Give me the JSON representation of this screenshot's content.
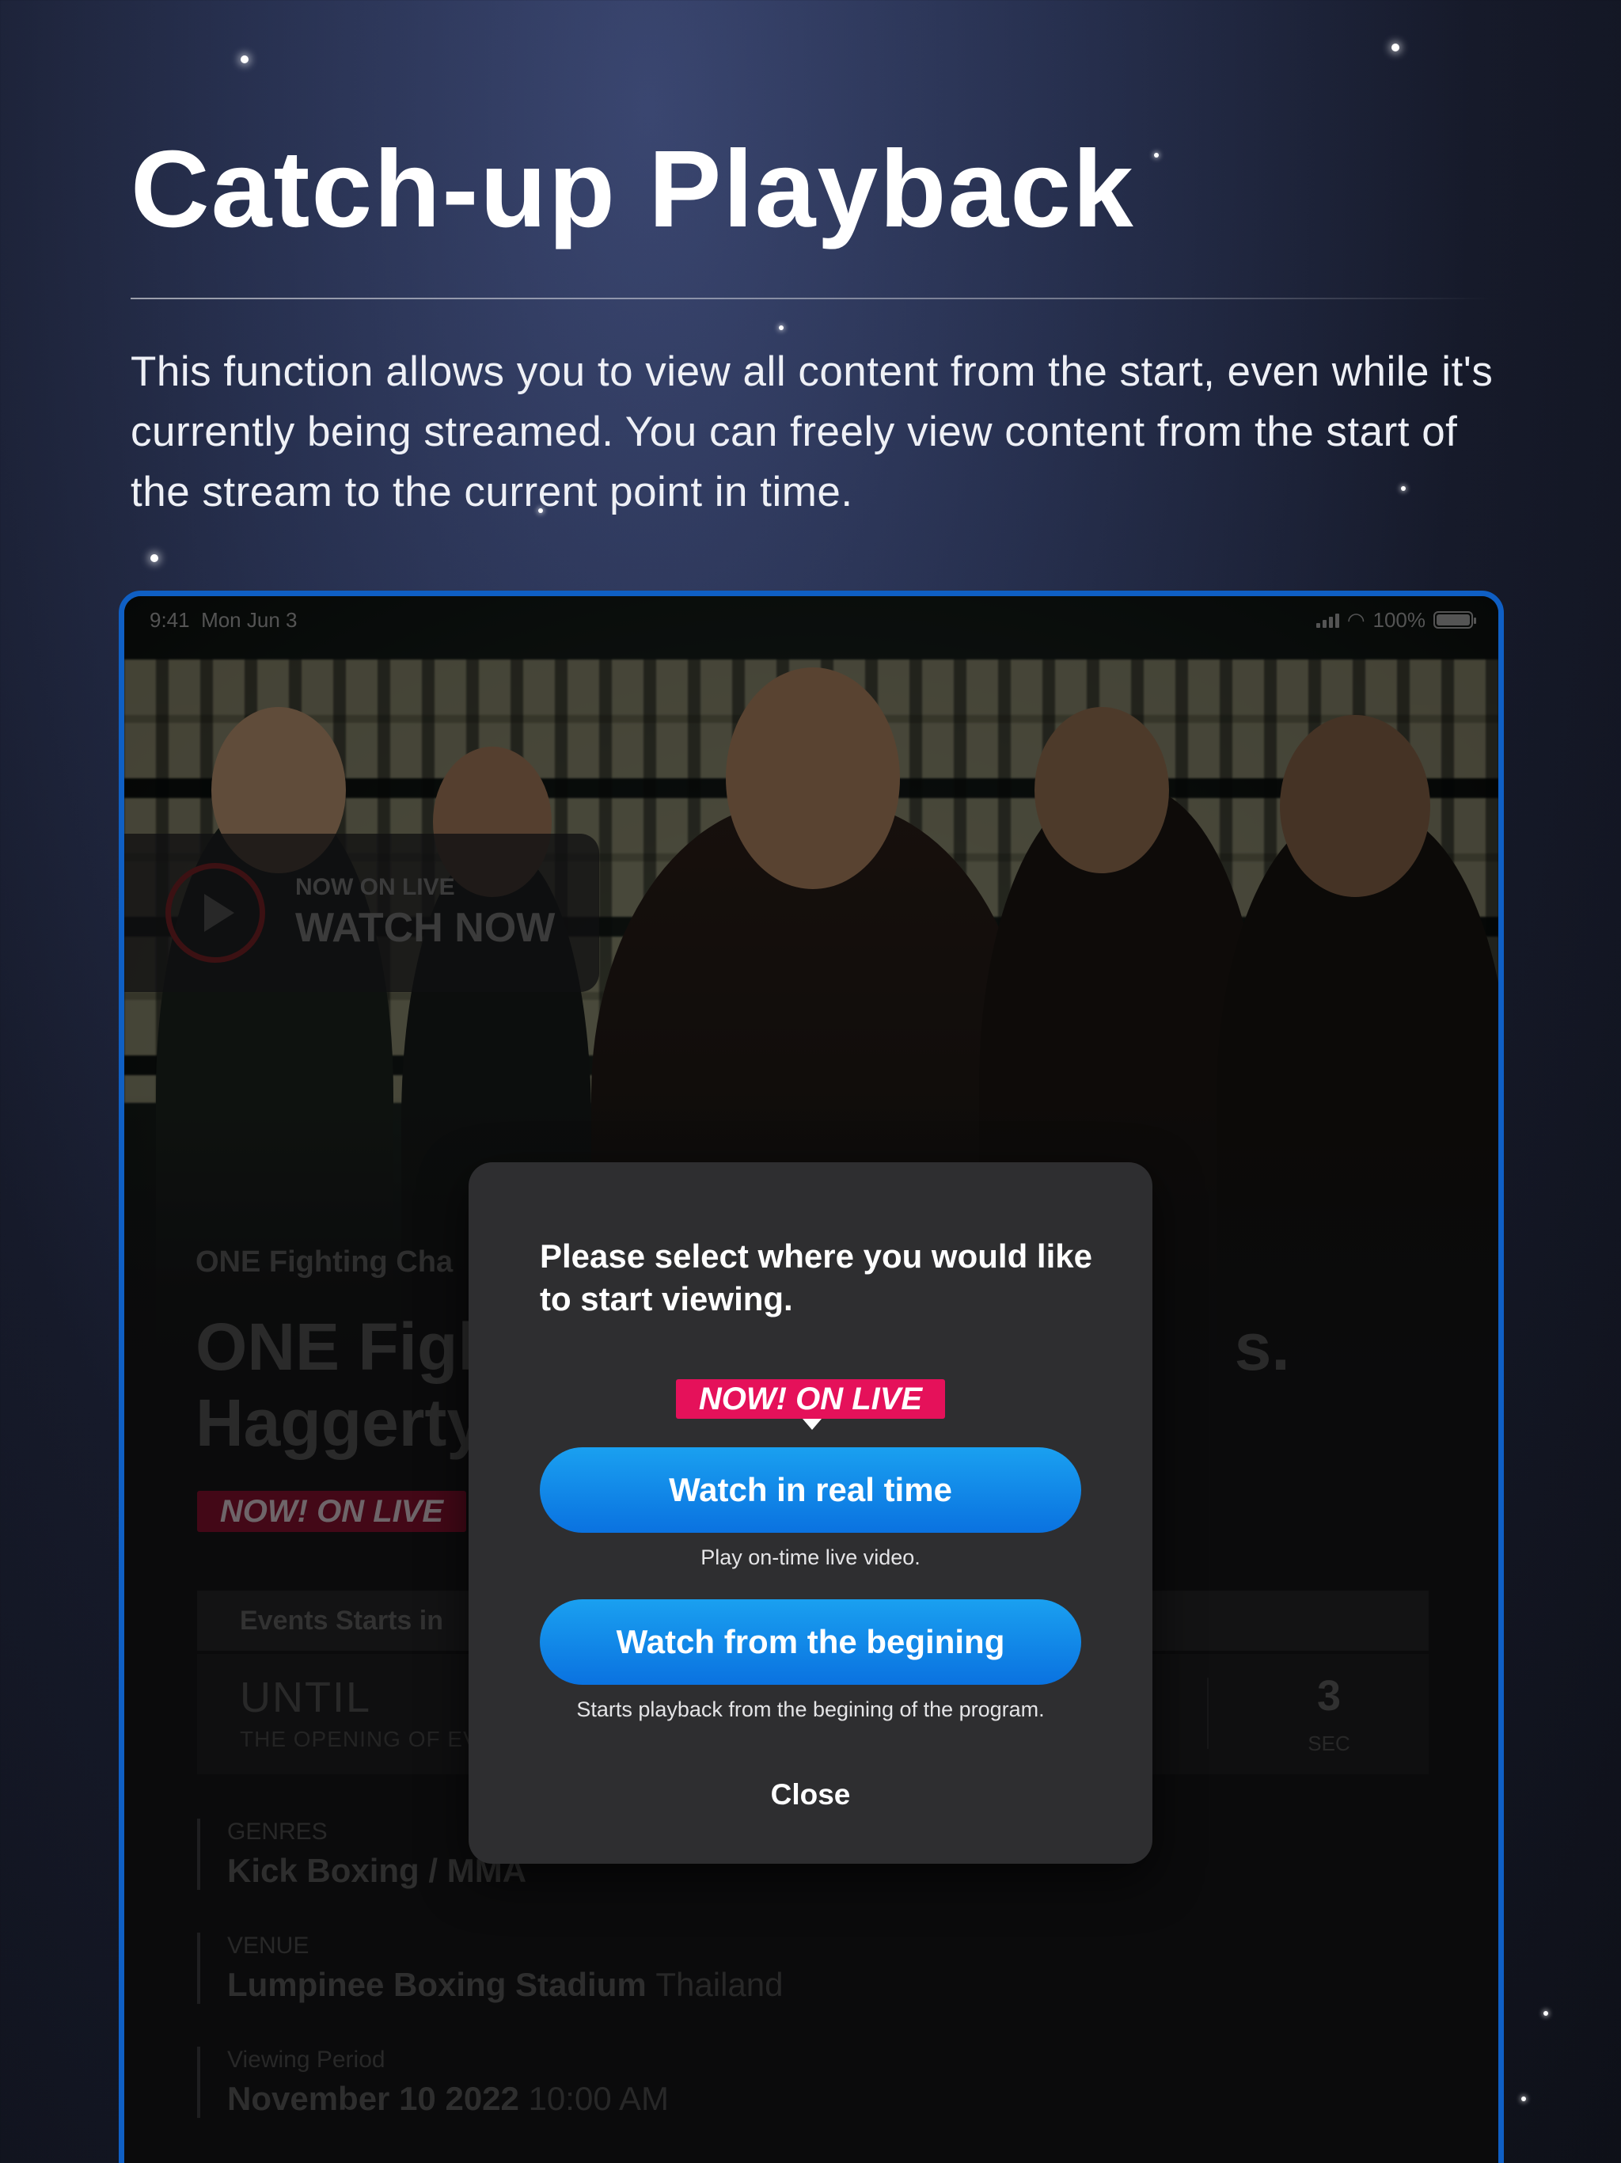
{
  "promo": {
    "title": "Catch-up Playback",
    "description": "This function allows you to view all content from the start, even while it's currently being streamed. You can freely view content from the start of the stream to the current point in time."
  },
  "status_bar": {
    "time": "9:41",
    "date": "Mon Jun 3",
    "battery": "100%"
  },
  "live_banner": {
    "label": "NOW ON LIVE",
    "action": "WATCH NOW"
  },
  "event": {
    "subtitle": "ONE Fighting Cha",
    "title_line1": "ONE Figh",
    "title_suffix": "s.",
    "title_line2": "Haggerty",
    "badge": "NOW! ON LIVE"
  },
  "countdown": {
    "header": "Events Starts in",
    "until": "UNTIL",
    "opening": "THE OPENING OF EV",
    "seconds_value": "3",
    "seconds_unit": "SEC"
  },
  "details": {
    "genres_label": "GENRES",
    "genres_value": "Kick Boxing / MMA",
    "venue_label": "VENUE",
    "venue_value": "Lumpinee Boxing Stadium",
    "venue_country": "Thailand",
    "period_label": "Viewing Period",
    "period_date": "November 10 2022",
    "period_time": "10:00 AM"
  },
  "modal": {
    "title": "Please select where you would like to start viewing.",
    "badge": "NOW! ON LIVE",
    "realtime_button": "Watch in real time",
    "realtime_note": "Play on-time live video.",
    "begin_button": "Watch from the begining",
    "begin_note": "Starts playback from the begining of the program.",
    "close": "Close"
  },
  "colors": {
    "accent_blue": "#0a72e0",
    "live_pink": "#e5115a",
    "device_frame": "#0f5fc4"
  }
}
